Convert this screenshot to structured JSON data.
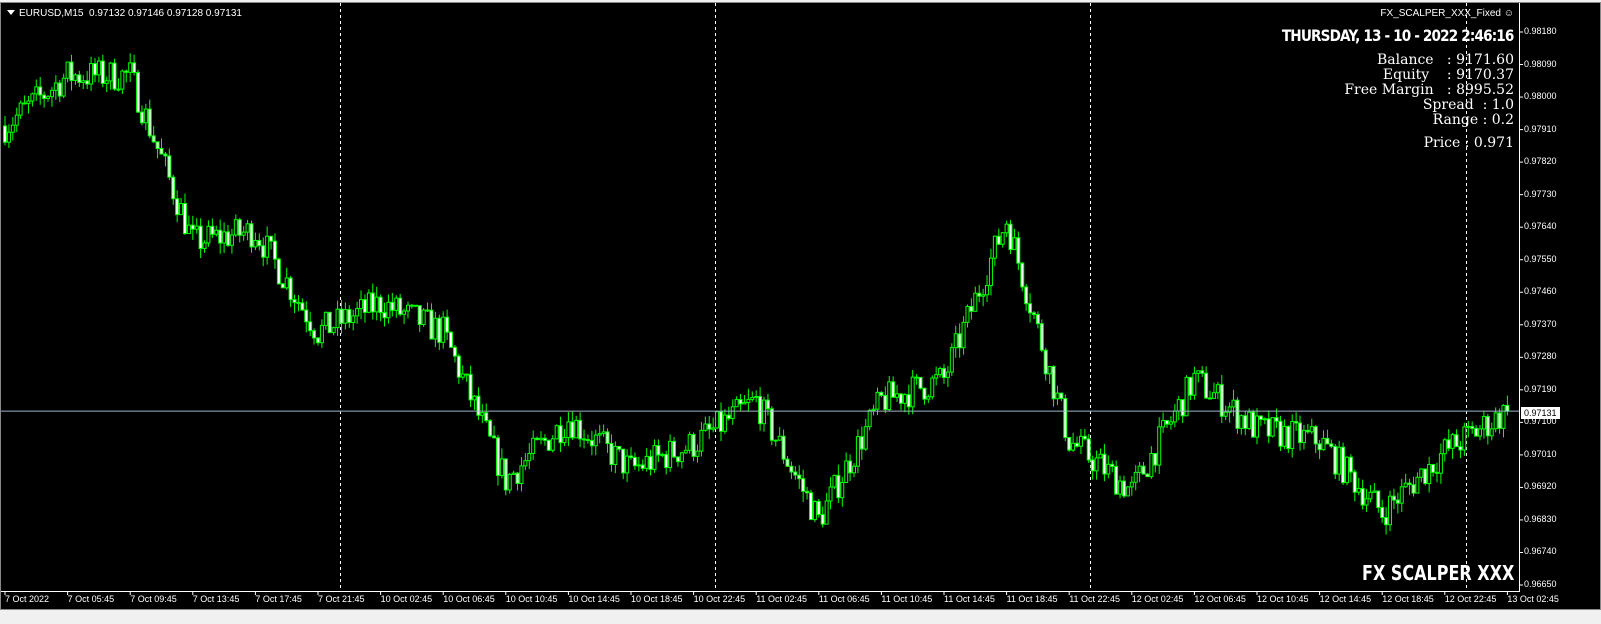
{
  "header": {
    "symbol": "EURUSD,M15",
    "ohlc": "0.97132 0.97146 0.97128 0.97131"
  },
  "expert": {
    "name": "FX_SCALPER_XXX_Fixed",
    "icon": "smiley-icon"
  },
  "panel": {
    "date": "THURSDAY, 13 - 10 - 2022 2:46:16",
    "lines": [
      "Balance   : 9171.60",
      "Equity    : 9170.37",
      "Free Margin   : 8995.52",
      "Spread  : 1.0",
      "Range : 0.2",
      "Price : 0.971"
    ]
  },
  "brand": "FX SCALPER XXX",
  "colors": {
    "bull": "#00ff00",
    "bg": "#000000",
    "grid": "#ffffff",
    "price_line": "#a0b4c8"
  },
  "chart_data": {
    "type": "candlestick",
    "current_price": "0.97131",
    "price_ticks": [
      "0.98180",
      "0.98090",
      "0.98000",
      "0.97910",
      "0.97820",
      "0.97730",
      "0.97640",
      "0.97550",
      "0.97460",
      "0.97370",
      "0.97280",
      "0.97190",
      "0.97100",
      "0.97010",
      "0.96920",
      "0.96830",
      "0.96740",
      "0.96650"
    ],
    "time_ticks": [
      "7 Oct 2022",
      "7 Oct 05:45",
      "7 Oct 09:45",
      "7 Oct 13:45",
      "7 Oct 17:45",
      "7 Oct 21:45",
      "10 Oct 02:45",
      "10 Oct 06:45",
      "10 Oct 10:45",
      "10 Oct 14:45",
      "10 Oct 18:45",
      "10 Oct 22:45",
      "11 Oct 02:45",
      "11 Oct 06:45",
      "11 Oct 10:45",
      "11 Oct 14:45",
      "11 Oct 18:45",
      "11 Oct 22:45",
      "12 Oct 02:45",
      "12 Oct 06:45",
      "12 Oct 10:45",
      "12 Oct 14:45",
      "12 Oct 18:45",
      "12 Oct 22:45",
      "13 Oct 02:45"
    ],
    "approx_close_at_ticks": [
      0.9792,
      0.9806,
      0.9806,
      0.976,
      0.9763,
      0.9735,
      0.9743,
      0.9735,
      0.9694,
      0.9711,
      0.9697,
      0.9704,
      0.9716,
      0.9683,
      0.9716,
      0.9722,
      0.9766,
      0.9705,
      0.9691,
      0.9722,
      0.9708,
      0.9705,
      0.9685,
      0.9702,
      0.97131
    ],
    "ylim": [
      0.9662,
      0.9821
    ]
  }
}
